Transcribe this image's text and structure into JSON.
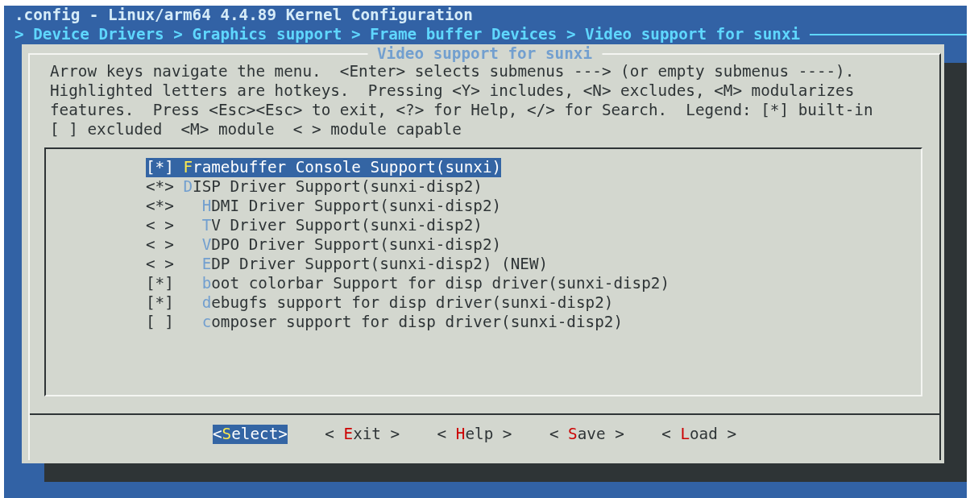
{
  "window": {
    "title": ".config - Linux/arm64 4.4.89 Kernel Configuration"
  },
  "breadcrumb": "> Device Drivers > Graphics support > Frame buffer Devices > Video support for sunxi",
  "dialog": {
    "title": "Video support for sunxi",
    "help": "Arrow keys navigate the menu.  <Enter> selects submenus ---> (or empty submenus ----).\nHighlighted letters are hotkeys.  Pressing <Y> includes, <N> excludes, <M> modularizes\nfeatures.  Press <Esc><Esc> to exit, <?> for Help, </> for Search.  Legend: [*] built-in\n[ ] excluded  <M> module  < > module capable",
    "items": [
      {
        "box": "[*]",
        "label": "Framebuffer Console Support(sunxi)",
        "selected": true
      },
      {
        "box": "<*>",
        "label": "DISP Driver Support(sunxi-disp2)",
        "selected": false,
        "children": [
          {
            "box": "<*>",
            "label": "HDMI Driver Support(sunxi-disp2)",
            "selected": false
          },
          {
            "box": "< >",
            "label": "TV Driver Support(sunxi-disp2)",
            "selected": false
          },
          {
            "box": "< >",
            "label": "VDPO Driver Support(sunxi-disp2)",
            "selected": false
          },
          {
            "box": "< >",
            "label": "EDP Driver Support(sunxi-disp2) (NEW)",
            "selected": false
          },
          {
            "box": "[*]",
            "label": "boot colorbar Support for disp driver(sunxi-disp2)",
            "selected": false
          },
          {
            "box": "[*]",
            "label": "debugfs support for disp driver(sunxi-disp2)",
            "selected": false
          },
          {
            "box": "[ ]",
            "label": "composer support for disp driver(sunxi-disp2)",
            "selected": false
          }
        ]
      }
    ],
    "buttons": [
      {
        "label": "<Select>",
        "selected": true
      },
      {
        "label": "< Exit >",
        "selected": false
      },
      {
        "label": "< Help >",
        "selected": false
      },
      {
        "label": "< Save >",
        "selected": false
      },
      {
        "label": "< Load >",
        "selected": false
      }
    ]
  }
}
